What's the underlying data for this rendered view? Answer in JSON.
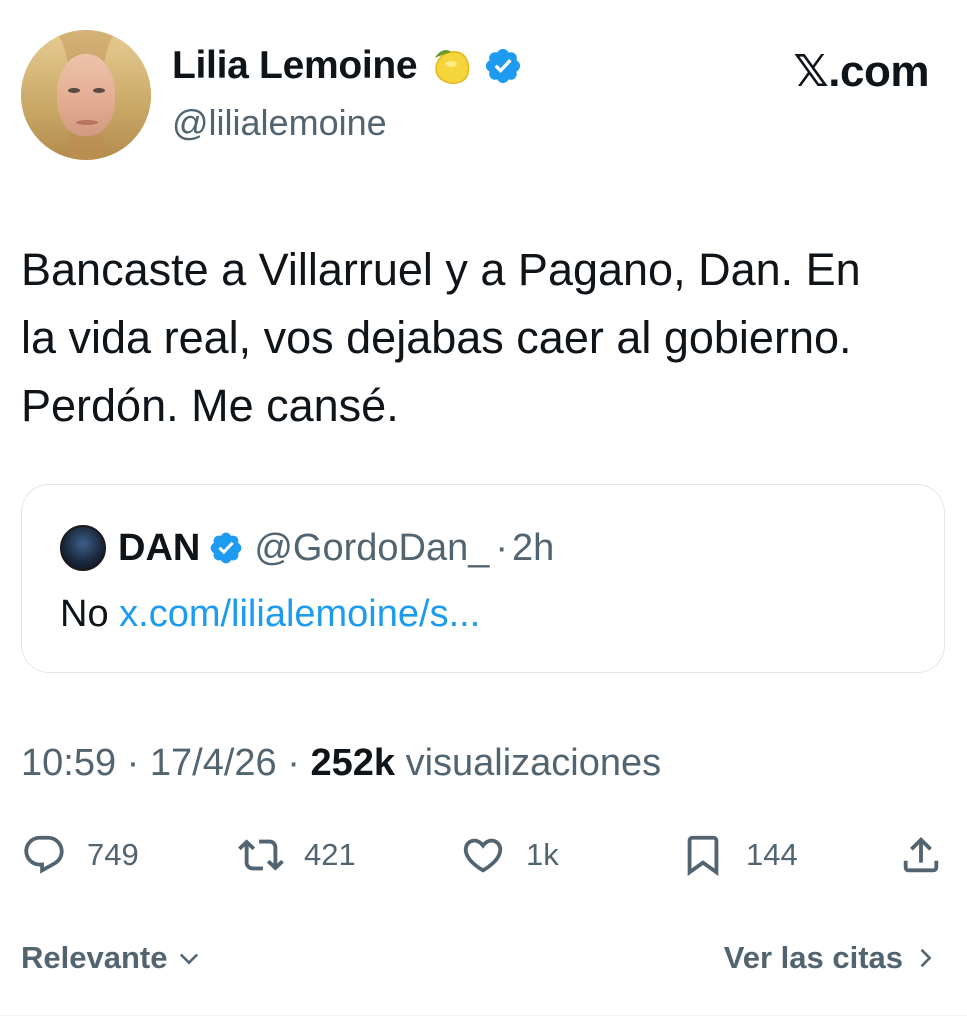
{
  "header": {
    "display_name": "Lilia Lemoine",
    "handle": "@lilialemoine",
    "site_label": "𝕏.com",
    "name_emoji": "lemon-icon",
    "verified": true
  },
  "tweet": {
    "text_lines": [
      "Bancaste a Villarruel y a Pagano, Dan. En",
      "la vida real, vos dejabas caer al gobierno.",
      "Perdón. Me cansé."
    ]
  },
  "quote": {
    "name": "DAN",
    "handle": "@GordoDan_",
    "separator": "·",
    "time": "2h",
    "body_prefix": "No",
    "link_text": "x.com/lilialemoine/s..."
  },
  "meta": {
    "time": "10:59",
    "date": "17/4/26",
    "views_count": "252k",
    "views_label": "visualizaciones",
    "separator": "·"
  },
  "actions": {
    "replies": "749",
    "reposts": "421",
    "likes": "1k",
    "bookmarks": "144"
  },
  "footer": {
    "sort_label": "Relevante",
    "quotes_link": "Ver las citas"
  },
  "colors": {
    "accent_blue": "#1d9bf0",
    "muted_text": "#536471",
    "primary_text": "#0f1419"
  }
}
